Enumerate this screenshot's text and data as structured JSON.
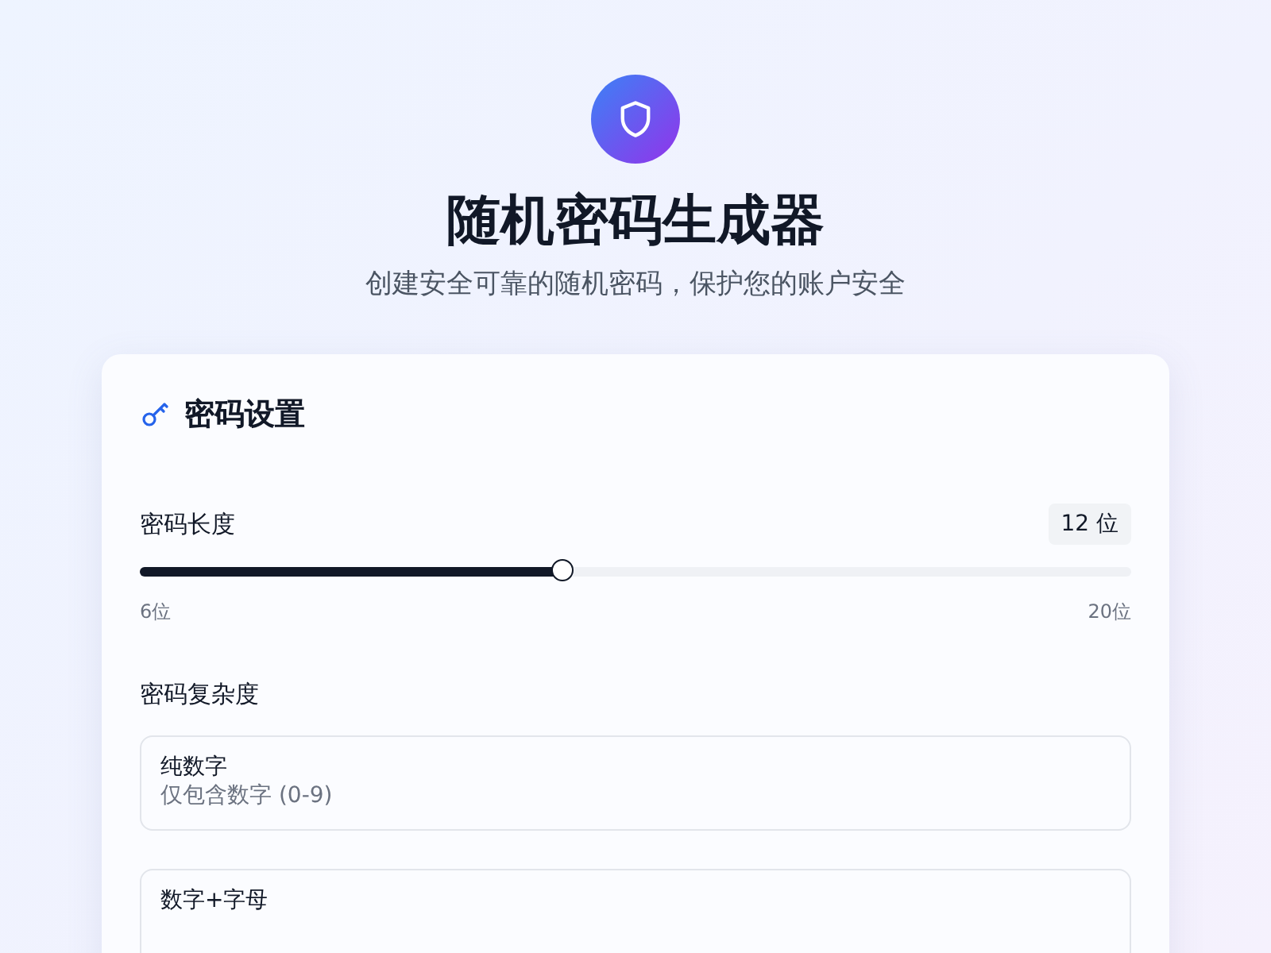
{
  "header": {
    "title": "随机密码生成器",
    "subtitle": "创建安全可靠的随机密码，保护您的账户安全"
  },
  "settings": {
    "title": "密码设置",
    "length": {
      "label": "密码长度",
      "value": "12",
      "unit": "位",
      "level": 0.4286,
      "min_label": "6位",
      "max_label": "20位"
    },
    "complexity": {
      "label": "密码复杂度",
      "options": [
        {
          "title": "纯数字",
          "description": "仅包含数字 (0-9)"
        },
        {
          "title": "数字+字母"
        }
      ]
    }
  }
}
